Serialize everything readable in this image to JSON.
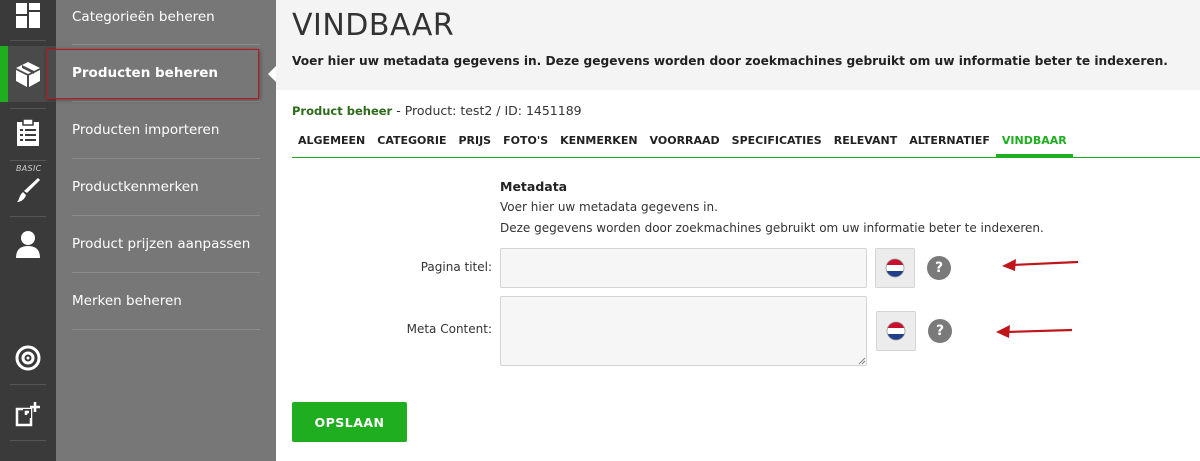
{
  "sidebar": {
    "rail": [
      {
        "icon": "dashboard-icon"
      },
      {
        "icon": "box-icon",
        "active": true
      },
      {
        "icon": "clipboard-icon"
      },
      {
        "icon": "paintbrush-icon",
        "tag": "BASIC"
      },
      {
        "icon": "user-icon"
      },
      {
        "icon": "lifebuoy-icon"
      },
      {
        "icon": "external-add-icon"
      }
    ],
    "menu": [
      {
        "label": "Categorieën beheren"
      },
      {
        "label": "Producten beheren",
        "active": true
      },
      {
        "label": "Producten importeren"
      },
      {
        "label": "Productkenmerken"
      },
      {
        "label": "Product prijzen aanpassen"
      },
      {
        "label": "Merken beheren"
      }
    ]
  },
  "header": {
    "title": "VINDBAAR",
    "subtitle": "Voer hier uw metadata gegevens in. Deze gegevens worden door zoekmachines gebruikt om uw informatie beter te indexeren."
  },
  "breadcrumb": {
    "link": "Product beheer",
    "rest": " - Product: test2 / ID: 1451189"
  },
  "tabs": [
    {
      "label": "ALGEMEEN"
    },
    {
      "label": "CATEGORIE"
    },
    {
      "label": "PRIJS"
    },
    {
      "label": "FOTO'S"
    },
    {
      "label": "KENMERKEN"
    },
    {
      "label": "VOORRAAD"
    },
    {
      "label": "SPECIFICATIES"
    },
    {
      "label": "RELEVANT"
    },
    {
      "label": "ALTERNATIEF"
    },
    {
      "label": "VINDBAAR",
      "active": true
    }
  ],
  "metadata": {
    "heading": "Metadata",
    "desc1": "Voer hier uw metadata gegevens in.",
    "desc2": "Deze gegevens worden door zoekmachines gebruikt om uw informatie beter te indexeren.",
    "fields": [
      {
        "label": "Pagina titel:",
        "value": "",
        "flag": "netherlands-flag-icon"
      },
      {
        "label": "Meta Content:",
        "value": "",
        "flag": "netherlands-flag-icon"
      }
    ],
    "help_symbol": "?"
  },
  "save_label": "OPSLAAN",
  "colors": {
    "accent": "#1fae1f",
    "rail": "#3a3a3a",
    "submenu": "#777777",
    "annotation": "#c0161b"
  }
}
